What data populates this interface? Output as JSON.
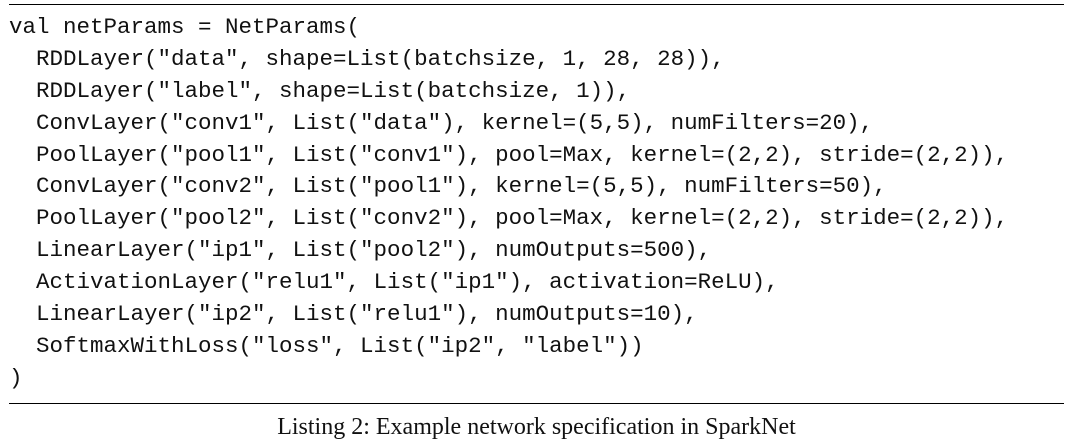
{
  "listing": {
    "lines": [
      "val netParams = NetParams(",
      "  RDDLayer(\"data\", shape=List(batchsize, 1, 28, 28)),",
      "  RDDLayer(\"label\", shape=List(batchsize, 1)),",
      "  ConvLayer(\"conv1\", List(\"data\"), kernel=(5,5), numFilters=20),",
      "  PoolLayer(\"pool1\", List(\"conv1\"), pool=Max, kernel=(2,2), stride=(2,2)),",
      "  ConvLayer(\"conv2\", List(\"pool1\"), kernel=(5,5), numFilters=50),",
      "  PoolLayer(\"pool2\", List(\"conv2\"), pool=Max, kernel=(2,2), stride=(2,2)),",
      "  LinearLayer(\"ip1\", List(\"pool2\"), numOutputs=500),",
      "  ActivationLayer(\"relu1\", List(\"ip1\"), activation=ReLU),",
      "  LinearLayer(\"ip2\", List(\"relu1\"), numOutputs=10),",
      "  SoftmaxWithLoss(\"loss\", List(\"ip2\", \"label\"))",
      ")"
    ],
    "caption": "Listing 2: Example network specification in SparkNet"
  }
}
